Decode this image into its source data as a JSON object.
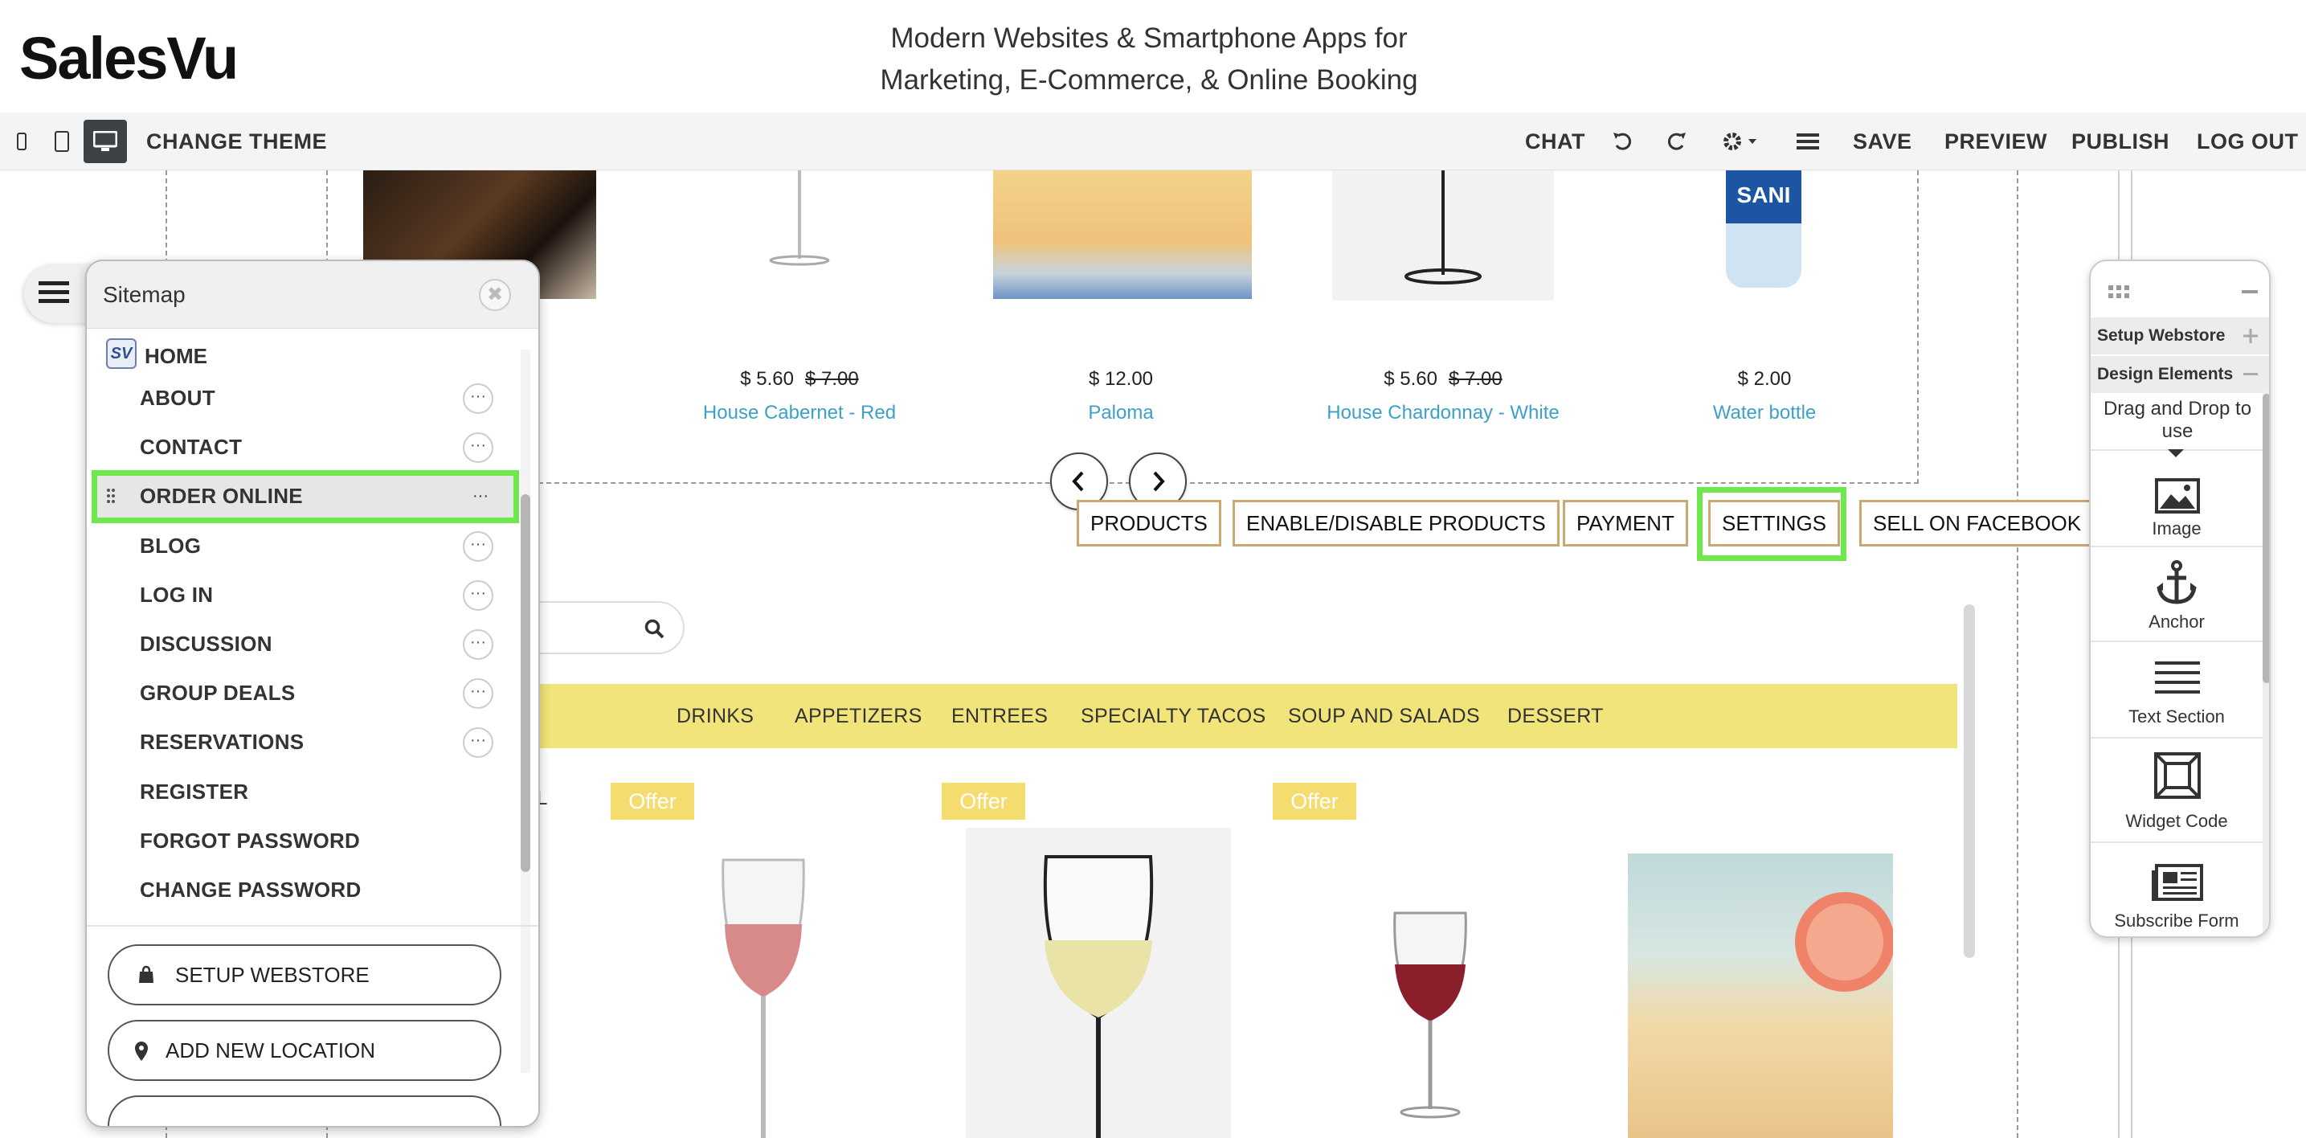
{
  "header": {
    "logo": "SalesVu",
    "tagline_line1": "Modern Websites & Smartphone Apps for",
    "tagline_line2": "Marketing, E-Commerce, & Online Booking"
  },
  "toolbar": {
    "change_theme": "CHANGE THEME",
    "chat": "CHAT",
    "save": "SAVE",
    "preview": "PREVIEW",
    "publish": "PUBLISH",
    "logout": "LOG OUT",
    "active_device": "desktop"
  },
  "products_top": [
    {
      "price": "$ 5.60",
      "old_price": "$ 7.00",
      "name": "House Cabernet - Red"
    },
    {
      "price": "$ 12.00",
      "old_price": "",
      "name": "Paloma"
    },
    {
      "price": "$ 5.60",
      "old_price": "$ 7.00",
      "name": "House Chardonnay - White"
    },
    {
      "price": "$ 2.00",
      "old_price": "",
      "name": "Water bottle"
    }
  ],
  "store_tabs": [
    "PRODUCTS",
    "ENABLE/DISABLE PRODUCTS",
    "PAYMENT",
    "SETTINGS",
    "SELL ON FACEBOOK"
  ],
  "highlighted_tab": "SETTINGS",
  "categories": [
    "DRINKS",
    "APPETIZERS",
    "ENTREES",
    "SPECIALTY TACOS",
    "SOUP AND SALADS",
    "DESSERT"
  ],
  "offer_badge": "Offer",
  "partial_text": "L",
  "sitemap": {
    "title": "Sitemap",
    "home": "HOME",
    "items": [
      {
        "label": "ABOUT",
        "has_menu": true
      },
      {
        "label": "CONTACT",
        "has_menu": true
      },
      {
        "label": "ORDER ONLINE",
        "has_menu": true
      },
      {
        "label": "BLOG",
        "has_menu": true
      },
      {
        "label": "LOG IN",
        "has_menu": true
      },
      {
        "label": "DISCUSSION",
        "has_menu": true
      },
      {
        "label": "GROUP DEALS",
        "has_menu": true
      },
      {
        "label": "RESERVATIONS",
        "has_menu": true
      },
      {
        "label": "REGISTER",
        "has_menu": false
      },
      {
        "label": "FORGOT PASSWORD",
        "has_menu": false
      },
      {
        "label": "CHANGE PASSWORD",
        "has_menu": false
      }
    ],
    "highlighted_item": "ORDER ONLINE",
    "dots": "···",
    "buttons": {
      "setup_webstore": "SETUP WEBSTORE",
      "add_location": "ADD NEW LOCATION"
    }
  },
  "right_panel": {
    "setup_webstore": "Setup Webstore",
    "design_elements": "Design Elements",
    "drag_hint": "Drag and Drop to use",
    "tiles": [
      "Image",
      "Anchor",
      "Text Section",
      "Widget Code",
      "Subscribe Form"
    ]
  },
  "colors": {
    "highlight": "#6ee84c",
    "link": "#3da1c7",
    "category_bar": "#f1e47a",
    "offer": "#f4dc6e",
    "tab_border": "#c9a872"
  }
}
